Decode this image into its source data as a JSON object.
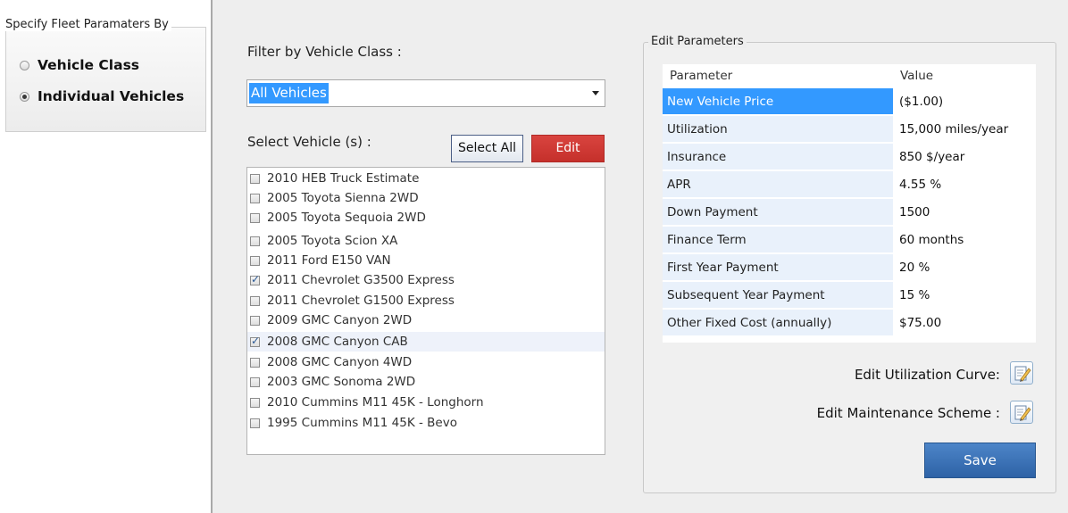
{
  "left_panel": {
    "group_title": "Specify Fleet Paramaters By",
    "options": [
      {
        "label": "Vehicle Class",
        "checked": false
      },
      {
        "label": "Individual Vehicles",
        "checked": true
      }
    ]
  },
  "filter": {
    "label": "Filter by Vehicle Class :",
    "selected_value": "All Vehicles"
  },
  "vehicles": {
    "label": "Select Vehicle (s) :",
    "select_all_label": "Select All",
    "edit_label": "Edit",
    "items": [
      {
        "name": "2010 HEB Truck Estimate",
        "checked": false
      },
      {
        "name": "2005 Toyota Sienna 2WD",
        "checked": false
      },
      {
        "name": "2005 Toyota Sequoia 2WD",
        "checked": false
      },
      {
        "name": "2005 Toyota Scion XA",
        "checked": false
      },
      {
        "name": "2011 Ford E150 VAN",
        "checked": false
      },
      {
        "name": "2011 Chevrolet G3500 Express",
        "checked": true
      },
      {
        "name": "2011 Chevrolet G1500 Express",
        "checked": false
      },
      {
        "name": "2009 GMC Canyon 2WD",
        "checked": false
      },
      {
        "name": "2008 GMC Canyon CAB",
        "checked": true
      },
      {
        "name": "2008 GMC Canyon 4WD",
        "checked": false
      },
      {
        "name": "2003 GMC Sonoma 2WD",
        "checked": false
      },
      {
        "name": "2010 Cummins M11 45K - Longhorn",
        "checked": false
      },
      {
        "name": "1995 Cummins M11 45K - Bevo",
        "checked": false
      }
    ]
  },
  "parameters": {
    "group_title": "Edit Parameters",
    "header_parameter": "Parameter",
    "header_value": "Value",
    "rows": [
      {
        "name": "New Vehicle Price",
        "value": "($1.00)"
      },
      {
        "name": "Utilization",
        "value": "15,000 miles/year"
      },
      {
        "name": "Insurance",
        "value": "850 $/year"
      },
      {
        "name": "APR",
        "value": "4.55 %"
      },
      {
        "name": "Down Payment",
        "value": "1500"
      },
      {
        "name": "Finance Term",
        "value": "60 months"
      },
      {
        "name": "First Year Payment",
        "value": "20 %"
      },
      {
        "name": "Subsequent Year Payment",
        "value": "15 %"
      },
      {
        "name": "Other Fixed Cost (annually)",
        "value": "$75.00"
      }
    ],
    "edit_utilization_label": "Edit Utilization Curve:",
    "edit_maintenance_label": "Edit Maintenance Scheme :",
    "save_label": "Save"
  },
  "colors": {
    "selection_blue": "#3399ff",
    "edit_red": "#c9322d",
    "save_blue": "#3a72b8"
  }
}
